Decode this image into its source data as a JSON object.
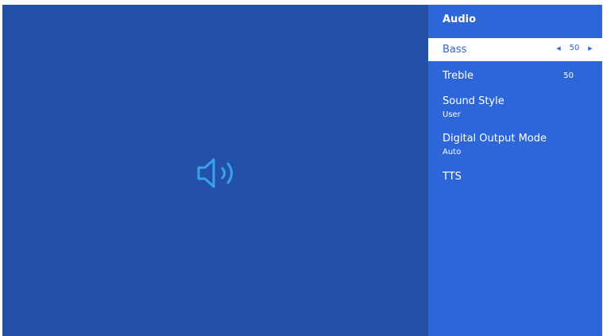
{
  "panel": {
    "title": "Audio",
    "items": [
      {
        "label": "Bass",
        "value": "50",
        "selected": true
      },
      {
        "label": "Treble",
        "value": "50"
      },
      {
        "label": "Sound Style",
        "sub": "User"
      },
      {
        "label": "Digital Output Mode",
        "sub": "Auto"
      },
      {
        "label": "TTS"
      }
    ]
  },
  "stepper": {
    "left_arrow": "◀",
    "right_arrow": "▶"
  },
  "preview": {
    "icon": "speaker-icon",
    "icon_color": "#3aa0f0"
  },
  "colors": {
    "preview_bg": "#2451a8",
    "panel_bg": "#2d66d8",
    "selected_bg": "#ffffff"
  }
}
